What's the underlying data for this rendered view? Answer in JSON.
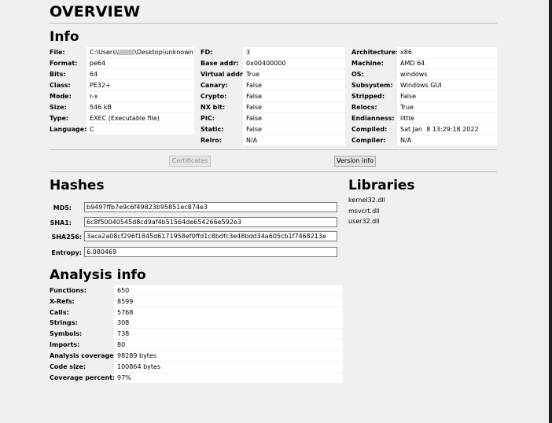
{
  "overview_title": "OVERVIEW",
  "info": {
    "title": "Info",
    "col1": [
      {
        "label": "File:",
        "value": "C:\\Users\\",
        "value2": "\\Desktop\\unknown.exe"
      },
      {
        "label": "Format:",
        "value": "pe64"
      },
      {
        "label": "Bits:",
        "value": "64"
      },
      {
        "label": "Class:",
        "value": "PE32+"
      },
      {
        "label": "Mode:",
        "value": "r-x"
      },
      {
        "label": "Size:",
        "value": "546 kB"
      },
      {
        "label": "Type:",
        "value": "EXEC (Executable file)"
      },
      {
        "label": "Language:",
        "value": "C"
      }
    ],
    "col2": [
      {
        "label": "FD:",
        "value": "3"
      },
      {
        "label": "Base addr:",
        "value": "0x00400000"
      },
      {
        "label": "Virtual addr:",
        "value": "True"
      },
      {
        "label": "Canary:",
        "value": "False"
      },
      {
        "label": "Crypto:",
        "value": "False"
      },
      {
        "label": "NX bit:",
        "value": "False"
      },
      {
        "label": "PIC:",
        "value": "False"
      },
      {
        "label": "Static:",
        "value": "False"
      },
      {
        "label": "Relro:",
        "value": "N/A"
      }
    ],
    "col3": [
      {
        "label": "Architecture:",
        "value": "x86"
      },
      {
        "label": "Machine:",
        "value": "AMD 64"
      },
      {
        "label": "OS:",
        "value": "windows"
      },
      {
        "label": "Subsystem:",
        "value": "Windows GUI"
      },
      {
        "label": "Stripped:",
        "value": "False"
      },
      {
        "label": "Relocs:",
        "value": "True"
      },
      {
        "label": "Endianness:",
        "value": "little"
      },
      {
        "label": "Compiled:",
        "value": "Sat Jan  8 13:29:18 2022"
      },
      {
        "label": "Compiler:",
        "value": "N/A"
      }
    ]
  },
  "buttons": {
    "certificates": "Certificates",
    "version_info": "Version info"
  },
  "hashes": {
    "title": "Hashes",
    "md5_label": "MD5:",
    "md5": "b9497ffb7e9c6f49823b95851ec874e3",
    "sha1_label": "SHA1:",
    "sha1": "6c8f50040545d8cd9af4b51564de654266e592e3",
    "sha256_label": "SHA256:",
    "sha256": "3aca2a08cf296f1845d6171958ef0ffd1c8bdfc3e48bdd34a605cb1f7468213e",
    "entropy_label": "Entropy:",
    "entropy": "6.080469"
  },
  "libraries": {
    "title": "Libraries",
    "items": [
      "kernel32.dll",
      "msvcrt.dll",
      "user32.dll"
    ]
  },
  "analysis": {
    "title": "Analysis info",
    "rows": [
      {
        "label": "Functions:",
        "value": "650"
      },
      {
        "label": "X-Refs:",
        "value": "8599"
      },
      {
        "label": "Calls:",
        "value": "5768"
      },
      {
        "label": "Strings:",
        "value": "308"
      },
      {
        "label": "Symbols:",
        "value": "738"
      },
      {
        "label": "Imports:",
        "value": "80"
      },
      {
        "label": "Analysis coverage:",
        "value": "98289 bytes"
      },
      {
        "label": "Code size:",
        "value": "100864 bytes"
      },
      {
        "label": "Coverage percent:",
        "value": "97%"
      }
    ]
  }
}
